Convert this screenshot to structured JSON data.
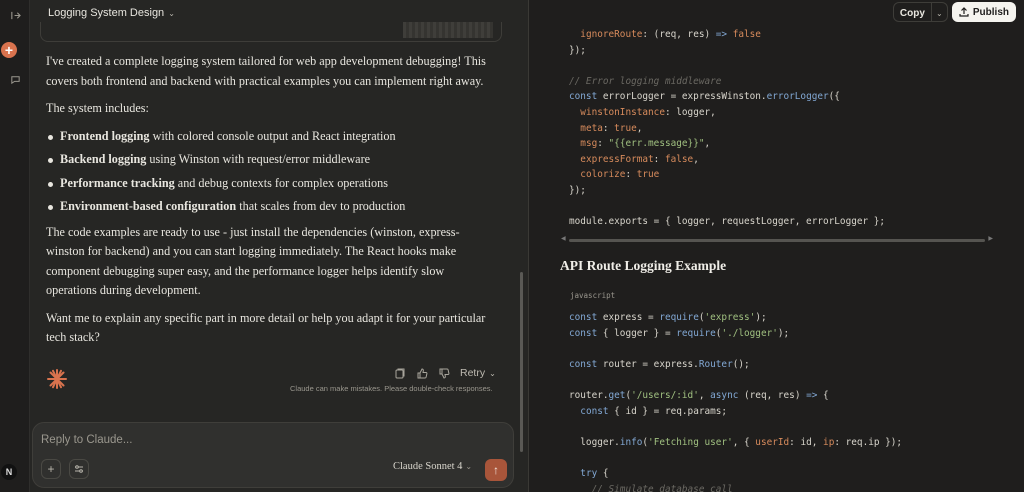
{
  "chat": {
    "title": "Logging System Design",
    "intro": "I've created a complete logging system tailored for web app development debugging! This covers both frontend and backend with practical examples you can implement right away.",
    "includes_heading": "The system includes:",
    "bullets": [
      {
        "bold": "Frontend logging",
        "rest": " with colored console output and React integration"
      },
      {
        "bold": "Backend logging",
        "rest": " using Winston with request/error middleware"
      },
      {
        "bold": "Performance tracking",
        "rest": " and debug contexts for complex operations"
      },
      {
        "bold": "Environment-based configuration",
        "rest": " that scales from dev to production"
      }
    ],
    "para2": "The code examples are ready to use - just install the dependencies (winston, express-winston for backend) and you can start logging immediately. The React hooks make component debugging super easy, and the performance logger helps identify slow operations during development.",
    "para3": "Want me to explain any specific part in more detail or help you adapt it for your particular tech stack?",
    "retry_label": "Retry",
    "disclaimer": "Claude can make mistakes. Please double-check responses.",
    "composer_placeholder": "Reply to Claude...",
    "model_label": "Claude Sonnet 4",
    "avatar_initial": "N"
  },
  "panel": {
    "copy_label": "Copy",
    "publish_label": "Publish",
    "section_heading": "API Route Logging Example",
    "lang_label": "javascript"
  },
  "colors": {
    "accent": "#d9734e",
    "send_button": "#a8553a",
    "background": "#262624",
    "panel_background": "#1f1e1d"
  }
}
